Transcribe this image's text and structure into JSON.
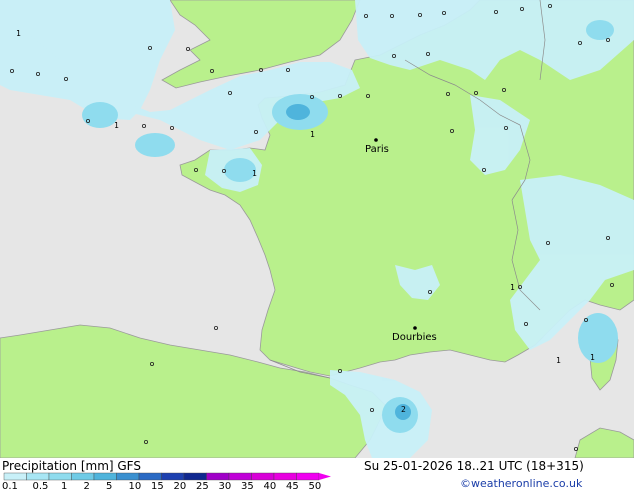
{
  "map": {
    "cities": [
      {
        "name": "Paris"
      },
      {
        "name": "Dourbies"
      }
    ],
    "point_values": [
      "1",
      "1",
      "1",
      "1",
      "1",
      "1",
      "1",
      "2"
    ]
  },
  "footer": {
    "title": "Precipitation [mm] GFS",
    "datetime": "Su 25-01-2026 18..21 UTC (18+315)",
    "credit": "©weatheronline.co.uk"
  },
  "legend": {
    "ticks": [
      "0.1",
      "0.5",
      "1",
      "2",
      "5",
      "10",
      "15",
      "20",
      "25",
      "30",
      "35",
      "40",
      "45",
      "50"
    ],
    "colors": [
      "#c8f0f8",
      "#a8e6f4",
      "#8fdcee",
      "#6fcbe6",
      "#4fb4dc",
      "#3a90d0",
      "#2a6ac4",
      "#1d40b0",
      "#102890",
      "#a000c8",
      "#c000d8",
      "#d800d8",
      "#e800e0",
      "#f000f0"
    ]
  },
  "colors": {
    "land": "#b9f08c",
    "sea_land_out": "#e6e6e6",
    "precip_light": "#c8f0f8",
    "precip_mid": "#8fdcee",
    "precip_heavy": "#4fb4dc",
    "border": "#a0a0a0"
  }
}
